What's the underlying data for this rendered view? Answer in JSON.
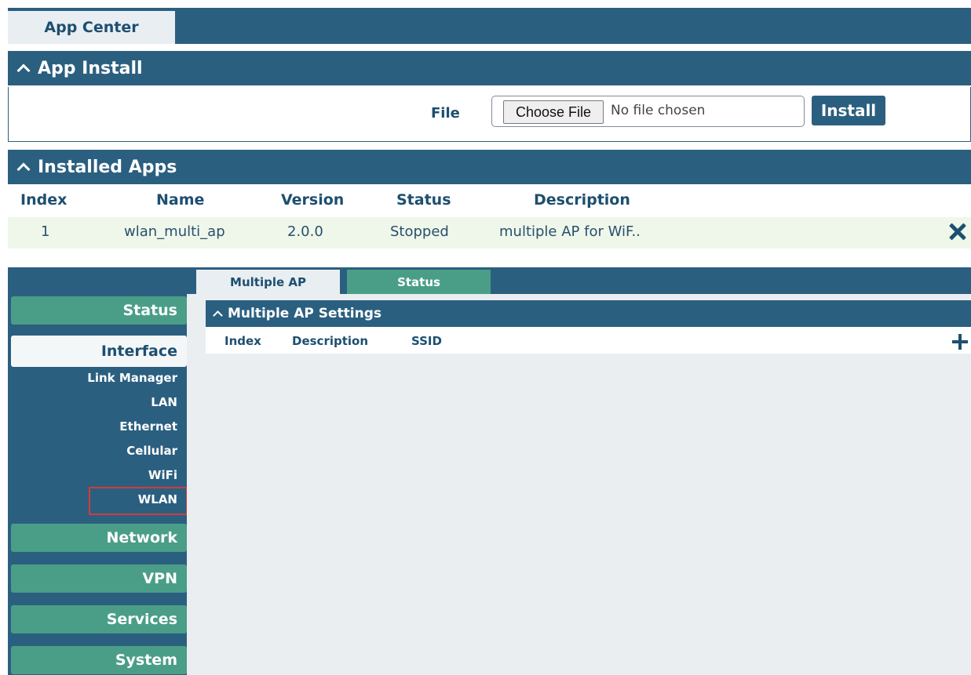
{
  "app_center": {
    "tab_label": "App Center",
    "app_install": {
      "title": "App Install",
      "file_label": "File",
      "choose_file_label": "Choose File",
      "no_file_text": "No file chosen",
      "install_label": "Install"
    },
    "installed_apps": {
      "title": "Installed Apps",
      "columns": [
        "Index",
        "Name",
        "Version",
        "Status",
        "Description"
      ],
      "rows": [
        {
          "index": "1",
          "name": "wlan_multi_ap",
          "version": "2.0.0",
          "status": "Stopped",
          "description": "multiple AP for WiF.."
        }
      ]
    }
  },
  "sidebar": {
    "items": [
      {
        "label": "Status"
      },
      {
        "label": "Interface"
      },
      {
        "label": "Network"
      },
      {
        "label": "VPN"
      },
      {
        "label": "Services"
      },
      {
        "label": "System"
      }
    ],
    "interface_sub": [
      "Link Manager",
      "LAN",
      "Ethernet",
      "Cellular",
      "WiFi",
      "WLAN"
    ]
  },
  "wlan_page": {
    "tabs": [
      "Multiple AP",
      "Status"
    ],
    "section_title": "Multiple AP Settings",
    "columns": [
      "Index",
      "Description",
      "SSID"
    ]
  },
  "colors": {
    "header": "#2b5f80",
    "nav_green": "#4a9e87",
    "highlight_box": "#d43b3b",
    "row_bg": "#eef7ea"
  }
}
